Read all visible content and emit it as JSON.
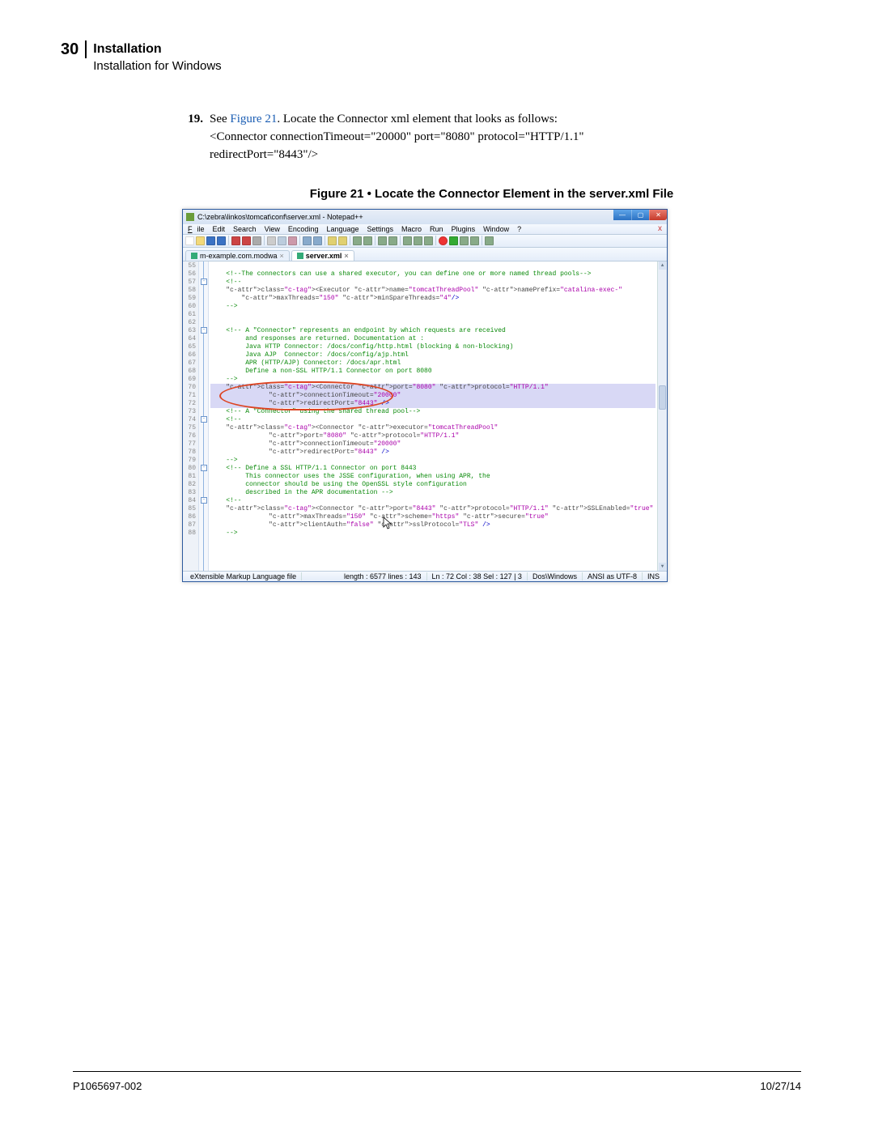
{
  "header": {
    "page_number": "30",
    "title": "Installation",
    "subtitle": "Installation for Windows"
  },
  "step": {
    "number": "19.",
    "pre_text": "See ",
    "link_text": "Figure 21",
    "post_text": ". Locate the Connector xml element that looks as follows:",
    "code_line1": "<Connector connectionTimeout=\"20000\" port=\"8080\" protocol=\"HTTP/1.1\"",
    "code_line2": "redirectPort=\"8443\"/>"
  },
  "figure": {
    "caption": "Figure 21 • Locate the Connector Element in the server.xml File"
  },
  "npp": {
    "title": "C:\\zebra\\linkos\\tomcat\\conf\\server.xml - Notepad++",
    "menubar": {
      "file": "File",
      "edit": "Edit",
      "search": "Search",
      "view": "View",
      "encoding": "Encoding",
      "language": "Language",
      "settings": "Settings",
      "macro": "Macro",
      "run": "Run",
      "plugins": "Plugins",
      "window": "Window",
      "help": "?"
    },
    "tabs": {
      "inactive": "m-example.com.modwa",
      "active": "server.xml"
    },
    "line_start": 55,
    "line_end": 88,
    "code_lines": [
      "",
      "    <!--The connectors can use a shared executor, you can define one or more named thread pools-->",
      "    <!--",
      "    <Executor name=\"tomcatThreadPool\" namePrefix=\"catalina-exec-\"",
      "        maxThreads=\"150\" minSpareThreads=\"4\"/>",
      "    -->",
      "",
      "",
      "    <!-- A \"Connector\" represents an endpoint by which requests are received",
      "         and responses are returned. Documentation at :",
      "         Java HTTP Connector: /docs/config/http.html (blocking & non-blocking)",
      "         Java AJP  Connector: /docs/config/ajp.html",
      "         APR (HTTP/AJP) Connector: /docs/apr.html",
      "         Define a non-SSL HTTP/1.1 Connector on port 8080",
      "    -->",
      "    <Connector port=\"8080\" protocol=\"HTTP/1.1\"",
      "               connectionTimeout=\"20000\"",
      "               redirectPort=\"8443\" />",
      "    <!-- A \"Connector\" using the shared thread pool-->",
      "    <!--",
      "    <Connector executor=\"tomcatThreadPool\"",
      "               port=\"8080\" protocol=\"HTTP/1.1\"",
      "               connectionTimeout=\"20000\"",
      "               redirectPort=\"8443\" />",
      "    -->",
      "    <!-- Define a SSL HTTP/1.1 Connector on port 8443",
      "         This connector uses the JSSE configuration, when using APR, the",
      "         connector should be using the OpenSSL style configuration",
      "         described in the APR documentation -->",
      "    <!--",
      "    <Connector port=\"8443\" protocol=\"HTTP/1.1\" SSLEnabled=\"true\"",
      "               maxThreads=\"150\" scheme=\"https\" secure=\"true\"",
      "               clientAuth=\"false\" sslProtocol=\"TLS\" />",
      "    -->"
    ],
    "status": {
      "filetype": "eXtensible Markup Language file",
      "length": "length : 6577   lines : 143",
      "pos": "Ln : 72   Col : 38   Sel : 127 | 3",
      "eol": "Dos\\Windows",
      "enc": "ANSI as UTF-8",
      "ins": "INS"
    }
  },
  "footer": {
    "left": "P1065697-002",
    "right": "10/27/14"
  }
}
